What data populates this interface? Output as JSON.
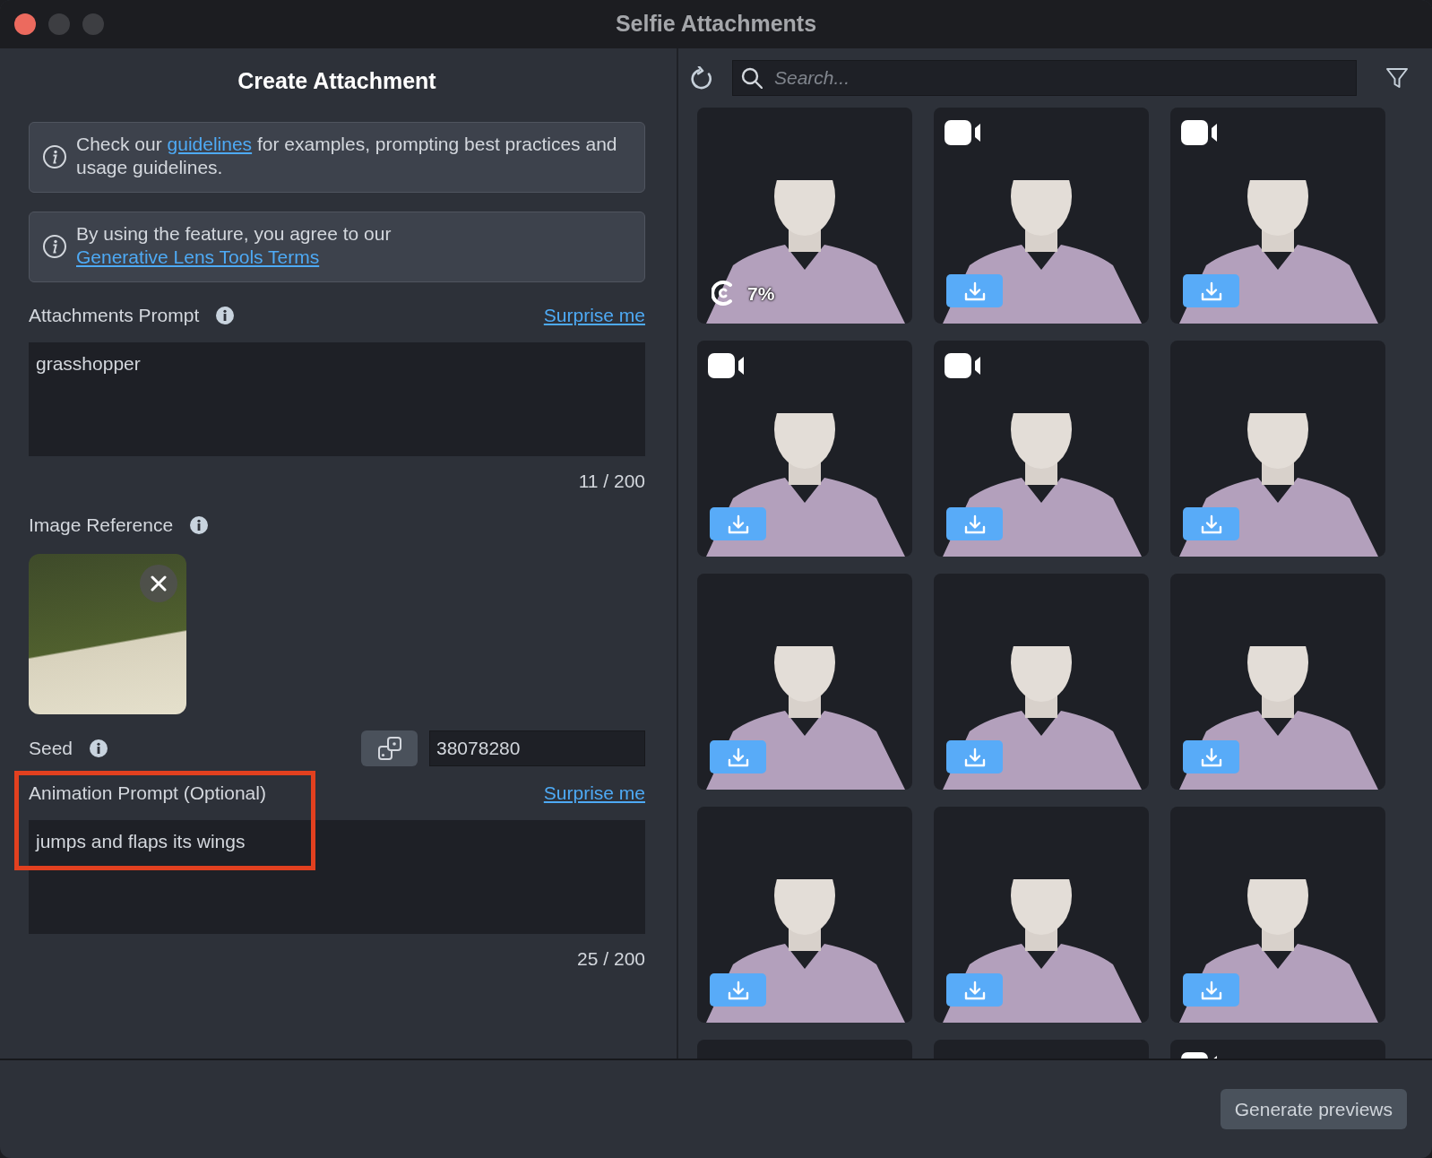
{
  "window": {
    "title": "Selfie Attachments"
  },
  "left_panel": {
    "title": "Create Attachment",
    "notices": [
      {
        "before": "Check our ",
        "link": "guidelines",
        "after": " for examples, prompting best practices and usage guidelines."
      },
      {
        "before": "By using the feature, you agree to our ",
        "link": "Generative Lens Tools Terms"
      }
    ],
    "attachments_prompt": {
      "label": "Attachments Prompt",
      "action": "Surprise me",
      "value": "grasshopper",
      "counter": "11 / 200"
    },
    "image_reference": {
      "label": "Image Reference"
    },
    "seed": {
      "label": "Seed",
      "value": "38078280"
    },
    "animation_prompt": {
      "label": "Animation Prompt (Optional)",
      "action": "Surprise me",
      "value": "jumps and flaps its wings",
      "counter": "25 / 200",
      "highlighted": true
    }
  },
  "gallery": {
    "search": {
      "placeholder": "Search..."
    },
    "tiles": [
      {
        "video": false,
        "kind": "progress",
        "progress": "7%"
      },
      {
        "video": true,
        "kind": "download"
      },
      {
        "video": true,
        "kind": "download"
      },
      {
        "video": true,
        "kind": "download"
      },
      {
        "video": true,
        "kind": "download"
      },
      {
        "video": false,
        "kind": "download"
      },
      {
        "video": false,
        "kind": "download"
      },
      {
        "video": false,
        "kind": "download"
      },
      {
        "video": false,
        "kind": "download"
      },
      {
        "video": false,
        "kind": "download"
      },
      {
        "video": false,
        "kind": "download"
      },
      {
        "video": false,
        "kind": "download"
      },
      {
        "video": false,
        "kind": "partial"
      },
      {
        "video": false,
        "kind": "partial"
      },
      {
        "video": true,
        "kind": "partial"
      }
    ]
  },
  "footer": {
    "button": "Generate previews"
  }
}
